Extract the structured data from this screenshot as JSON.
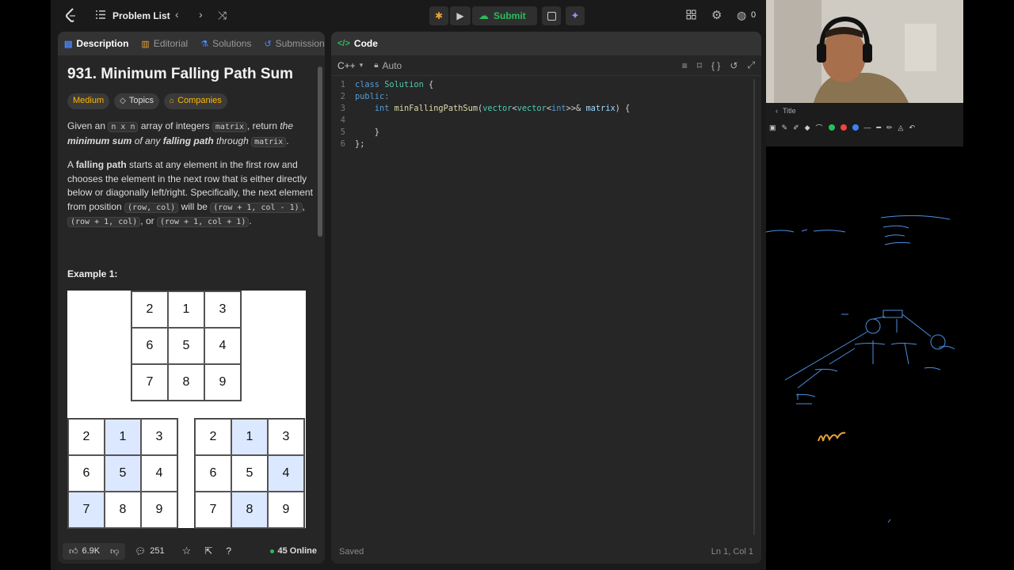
{
  "nav": {
    "problem_list": "Problem List",
    "submit": "Submit",
    "streak": "0"
  },
  "tabs": {
    "description": "Description",
    "editorial": "Editorial",
    "solutions": "Solutions",
    "submissions": "Submission"
  },
  "problem": {
    "title": "931. Minimum Falling Path Sum",
    "difficulty": "Medium",
    "topics": "Topics",
    "companies": "Companies",
    "p1_a": "Given an ",
    "p1_code1": "n x n",
    "p1_b": " array of integers ",
    "p1_code2": "matrix",
    "p1_c": ", return ",
    "p1_d": "the",
    "p1_e": "minimum sum",
    "p1_f": " of any ",
    "p1_g": "falling path",
    "p1_h": " through ",
    "p1_code3": "matrix",
    "p1_i": ".",
    "p2_a": "A ",
    "p2_b": "falling path",
    "p2_c": " starts at any element in the first row and chooses the element in the next row that is either directly below or diagonally left/right. Specifically, the next element from position ",
    "p2_code1": "(row, col)",
    "p2_d": " will be ",
    "p2_code2": "(row + 1, col - 1)",
    "p2_e": ", ",
    "p2_code3": "(row + 1, col)",
    "p2_f": ", or ",
    "p2_code4": "(row + 1, col + 1)",
    "p2_g": ".",
    "example_heading": "Example 1:",
    "grid_main": [
      "2",
      "1",
      "3",
      "6",
      "5",
      "4",
      "7",
      "8",
      "9"
    ],
    "grid_a": [
      "2",
      "1",
      "3",
      "6",
      "5",
      "4",
      "7",
      "8",
      "9"
    ],
    "grid_b": [
      "2",
      "1",
      "3",
      "6",
      "5",
      "4",
      "7",
      "8",
      "9"
    ]
  },
  "bottom": {
    "likes": "6.9K",
    "comments": "251",
    "online": "45 Online"
  },
  "editor": {
    "tab": "Code",
    "language": "C++",
    "mode": "Auto",
    "status": "Saved",
    "cursor": "Ln 1, Col 1",
    "lines": [
      {
        "n": "1",
        "parts": [
          {
            "c": "kw",
            "t": "class "
          },
          {
            "c": "ty",
            "t": "Solution"
          },
          {
            "c": "tx",
            "t": " {"
          }
        ]
      },
      {
        "n": "2",
        "parts": [
          {
            "c": "kw",
            "t": "public:"
          }
        ]
      },
      {
        "n": "3",
        "parts": [
          {
            "c": "tx",
            "t": "    "
          },
          {
            "c": "kw",
            "t": "int "
          },
          {
            "c": "fn",
            "t": "minFallingPathSum"
          },
          {
            "c": "tx",
            "t": "("
          },
          {
            "c": "ty",
            "t": "vector"
          },
          {
            "c": "tx",
            "t": "<"
          },
          {
            "c": "ty",
            "t": "vector"
          },
          {
            "c": "tx",
            "t": "<"
          },
          {
            "c": "kw",
            "t": "int"
          },
          {
            "c": "tx",
            "t": ">>& "
          },
          {
            "c": "id",
            "t": "matrix"
          },
          {
            "c": "tx",
            "t": ") {"
          }
        ]
      },
      {
        "n": "4",
        "parts": []
      },
      {
        "n": "5",
        "parts": [
          {
            "c": "tx",
            "t": "    }"
          }
        ]
      },
      {
        "n": "6",
        "parts": [
          {
            "c": "tx",
            "t": "};"
          }
        ]
      }
    ]
  },
  "side": {
    "title": "Title"
  },
  "colors": {
    "accent_green": "#2cbb5d",
    "medium": "#ffb800",
    "pen_blue": "#3b82f6"
  }
}
